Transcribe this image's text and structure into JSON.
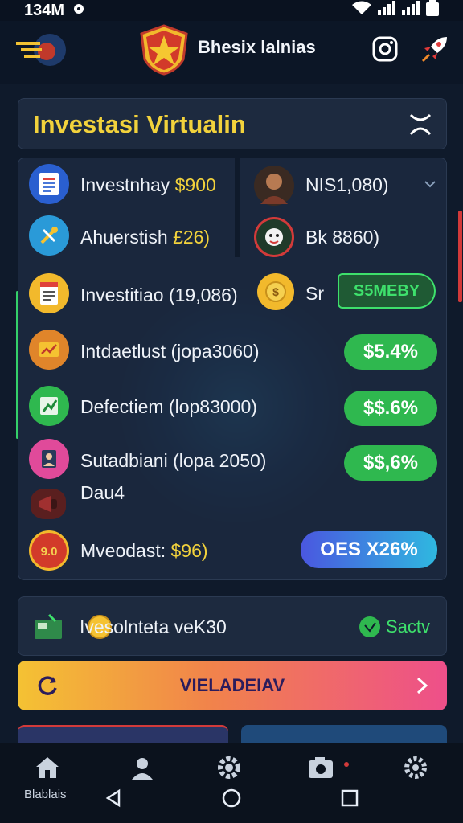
{
  "status_bar": {
    "time": "134M"
  },
  "app": {
    "title": "Bhesix lalnias"
  },
  "card": {
    "title": "Investasi Virtualin"
  },
  "rows": [
    {
      "label": "Investnhay",
      "value": "$900"
    },
    {
      "label": "Ahuerstish",
      "value": "£26)"
    },
    {
      "label": "Investitiao (19,086)",
      "value": ""
    },
    {
      "label": "Intdaetlust (jopa3060)",
      "value": ""
    },
    {
      "label": "Defectiem (lop83000)",
      "value": ""
    },
    {
      "label": "Sutadbiani (lopa 2050)",
      "value": ""
    },
    {
      "label": "Dau4",
      "value": ""
    },
    {
      "label": "Mveodast:",
      "value": "$96)"
    }
  ],
  "right_rows": [
    {
      "label": "NIS1,080)"
    },
    {
      "label": "Bk 8860)"
    },
    {
      "label": "Sr"
    }
  ],
  "pills": [
    {
      "label": "S5MEBY"
    },
    {
      "label": "$5.4%"
    },
    {
      "label": "$$.6%"
    },
    {
      "label": "$$,6%"
    },
    {
      "label": "OES X26%"
    }
  ],
  "info": {
    "text": "Ivesolnteta veK30",
    "state": "Sactv"
  },
  "cta": {
    "label": "VIELADEIAV"
  },
  "nav": {
    "label": "Blablais"
  },
  "colors": {
    "accent_yellow": "#f2d23c",
    "accent_green": "#2fb84f",
    "bg": "#0f1a2b"
  }
}
